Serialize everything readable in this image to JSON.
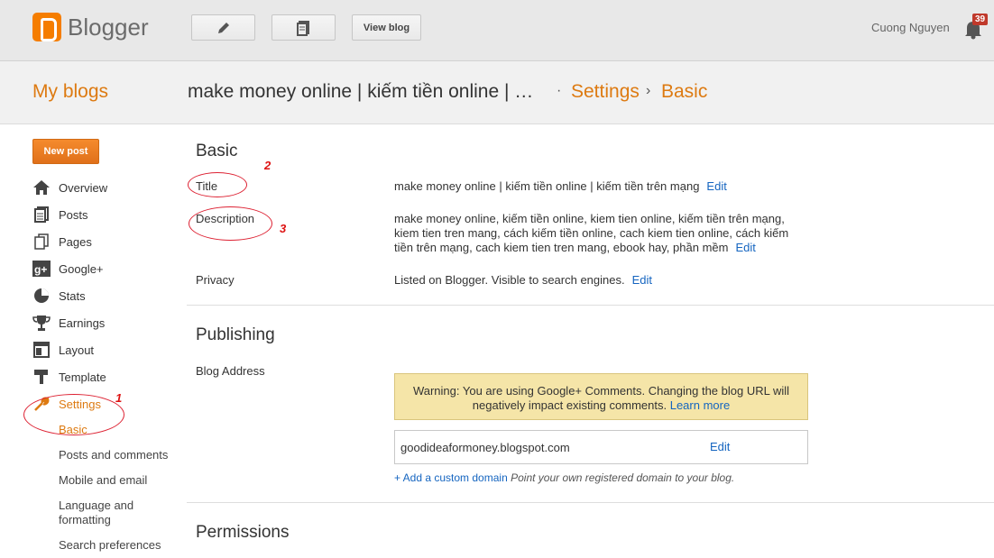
{
  "topbar": {
    "logo_text": "Blogger",
    "view_blog": "View blog",
    "user_name": "Cuong Nguyen",
    "notifications": "39"
  },
  "header": {
    "my_blogs": "My blogs",
    "blog_title": "make money online | kiếm tiền online | …",
    "dot": "·",
    "crumb_settings": "Settings",
    "chevron": "›",
    "crumb_basic": "Basic"
  },
  "sidebar": {
    "new_post": "New post",
    "items": [
      {
        "label": "Overview",
        "icon": "home-icon"
      },
      {
        "label": "Posts",
        "icon": "posts-icon"
      },
      {
        "label": "Pages",
        "icon": "pages-icon"
      },
      {
        "label": "Google+",
        "icon": "google-plus-icon"
      },
      {
        "label": "Stats",
        "icon": "stats-icon"
      },
      {
        "label": "Earnings",
        "icon": "trophy-icon"
      },
      {
        "label": "Layout",
        "icon": "layout-icon"
      },
      {
        "label": "Template",
        "icon": "template-icon"
      },
      {
        "label": "Settings",
        "icon": "wrench-icon"
      }
    ],
    "sub_items": [
      "Basic",
      "Posts and comments",
      "Mobile and email",
      "Language and formatting",
      "Search preferences"
    ]
  },
  "basic": {
    "heading": "Basic",
    "title_label": "Title",
    "title_value": "make money online | kiếm tiền online | kiếm tiền trên mạng",
    "description_label": "Description",
    "description_value": "make money online, kiếm tiền online, kiem tien online, kiếm tiền trên mạng, kiem tien tren mang, cách kiếm tiền online, cach kiem tien online, cách kiếm tiền trên mạng, cach kiem tien tren mang, ebook hay, phần mềm",
    "privacy_label": "Privacy",
    "privacy_value": "Listed on Blogger. Visible to search engines.",
    "edit": "Edit"
  },
  "publishing": {
    "heading": "Publishing",
    "blog_address_label": "Blog Address",
    "warning": "Warning: You are using Google+ Comments. Changing the blog URL will negatively impact existing comments.",
    "learn_more": "Learn more",
    "address": "goodideaformoney.blogspot.com",
    "edit": "Edit",
    "custom_domain_link": "+ Add a custom domain",
    "custom_domain_hint": "Point your own registered domain to your blog."
  },
  "permissions": {
    "heading": "Permissions"
  },
  "annotations": [
    "1",
    "2",
    "3"
  ],
  "colors": {
    "accent": "#dd7a11",
    "link": "#1565c0",
    "annotation": "#d11"
  }
}
